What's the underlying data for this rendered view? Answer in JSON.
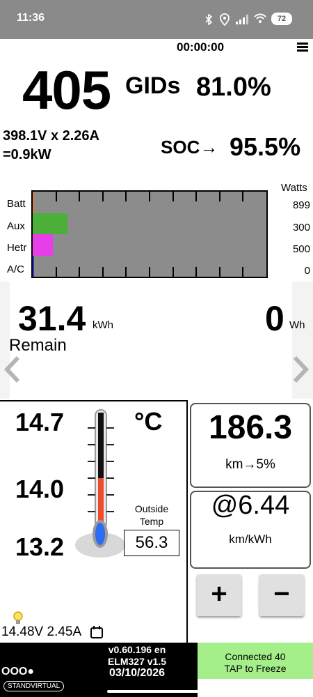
{
  "status_bar": {
    "time": "11:36",
    "battery": "72"
  },
  "timer": "00:00:00",
  "gids": {
    "value": "405",
    "label": "GIDs",
    "percent": "81.0%"
  },
  "power": {
    "line1": "398.1V x 2.26A",
    "line2": "=0.9kW"
  },
  "soc": {
    "label": "SOC→",
    "value": "95.5%"
  },
  "power_bars": {
    "header": "Watts",
    "rows": [
      {
        "label": "Batt",
        "value": "899",
        "fraction": 0.005,
        "color": "#d97b3a"
      },
      {
        "label": "Aux",
        "value": "300",
        "fraction": 0.15,
        "color": "#4caf3a"
      },
      {
        "label": "Hetr",
        "value": "500",
        "fraction": 0.085,
        "color": "#e83ee8"
      },
      {
        "label": "A/C",
        "value": "0",
        "fraction": 0.0,
        "color": "#2b3acb"
      }
    ]
  },
  "remain": {
    "value": "31.4",
    "unit": "kWh",
    "label": "Remain",
    "wh_value": "0",
    "wh_unit": "Wh"
  },
  "temperature": {
    "high": "14.7",
    "mid": "14.0",
    "low": "13.2",
    "unit": "°C",
    "outside_label_line1": "Outside",
    "outside_label_line2": "Temp",
    "outside_value": "56.3"
  },
  "range": {
    "value": "186.3",
    "sub": "km→5%"
  },
  "efficiency": {
    "value": "@6.44",
    "unit": "km/kWh"
  },
  "buttons": {
    "plus": "+",
    "minus": "−"
  },
  "aux_battery": "14.48V 2.45A",
  "footer": {
    "version_line1": "v0.60.196 en",
    "version_line2": "ELM327 v1.5",
    "date": "03/10/2026",
    "dots": "OOO●",
    "watermark": "STANDVIRTUAL",
    "connection_line1": "Connected 40",
    "connection_line2": "TAP to Freeze"
  }
}
